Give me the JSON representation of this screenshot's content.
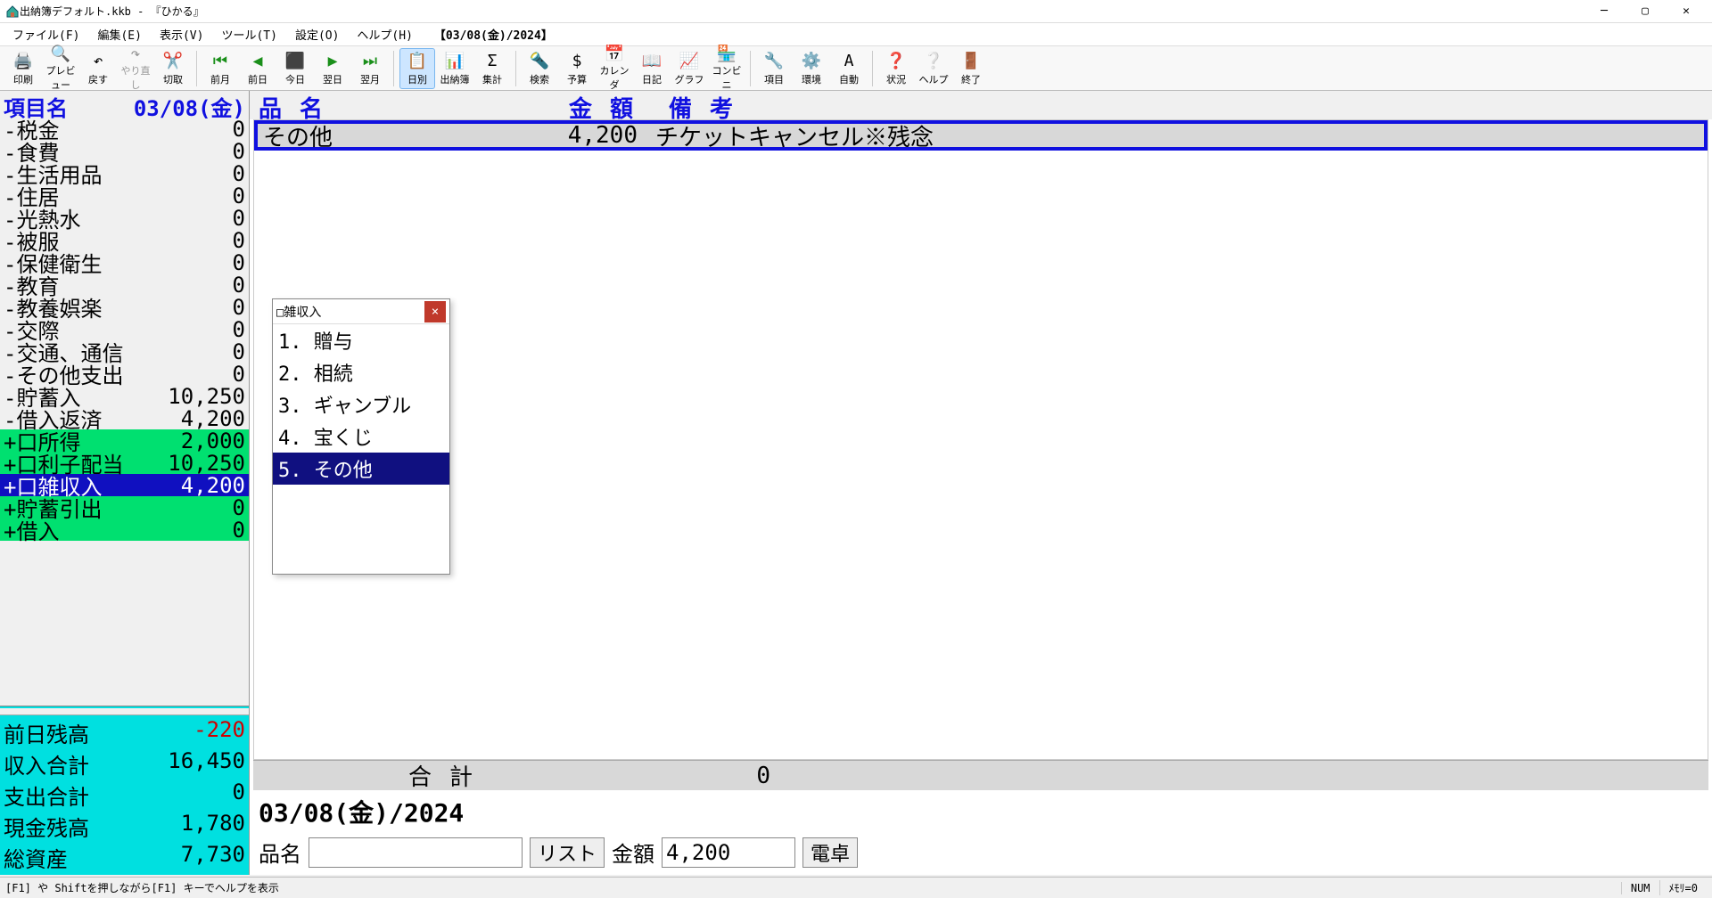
{
  "window": {
    "title": "出納簿デフォルト.kkb - 『ひかる』"
  },
  "menus": {
    "file": "ファイル(F)",
    "edit": "編集(E)",
    "view": "表示(V)",
    "tool": "ツール(T)",
    "setting": "設定(O)",
    "help": "ヘルプ(H)",
    "context": "【03/08(金)/2024】"
  },
  "toolbar": [
    {
      "id": "print",
      "lbl": "印刷",
      "ico": "🖨️"
    },
    {
      "id": "preview",
      "lbl": "プレビュー",
      "ico": "🔍"
    },
    {
      "id": "undo",
      "lbl": "戻す",
      "ico": "↶"
    },
    {
      "id": "redo",
      "lbl": "やり直し",
      "ico": "↷",
      "disabled": true
    },
    {
      "id": "cut",
      "lbl": "切取",
      "ico": "✂️"
    },
    {
      "sep": true
    },
    {
      "id": "prev-month",
      "lbl": "前月",
      "ico": "⏮",
      "color": "#1a8f1a"
    },
    {
      "id": "prev-day",
      "lbl": "前日",
      "ico": "◀",
      "color": "#1a8f1a"
    },
    {
      "id": "today",
      "lbl": "今日",
      "ico": "⬛",
      "color": "#1a8f1a"
    },
    {
      "id": "next-day",
      "lbl": "翌日",
      "ico": "▶",
      "color": "#1a8f1a"
    },
    {
      "id": "next-month",
      "lbl": "翌月",
      "ico": "⏭",
      "color": "#1a8f1a"
    },
    {
      "sep": true
    },
    {
      "id": "daily",
      "lbl": "日別",
      "ico": "📋",
      "active": true
    },
    {
      "id": "ledger",
      "lbl": "出納簿",
      "ico": "📊"
    },
    {
      "id": "summary",
      "lbl": "集計",
      "ico": "Σ"
    },
    {
      "sep": true
    },
    {
      "id": "search",
      "lbl": "検索",
      "ico": "🔦"
    },
    {
      "id": "budget",
      "lbl": "予算",
      "ico": "$"
    },
    {
      "id": "calendar",
      "lbl": "カレンダ",
      "ico": "📅"
    },
    {
      "id": "diary",
      "lbl": "日記",
      "ico": "📖"
    },
    {
      "id": "graph",
      "lbl": "グラフ",
      "ico": "📈"
    },
    {
      "id": "convini",
      "lbl": "コンビニ",
      "ico": "🏪"
    },
    {
      "sep": true
    },
    {
      "id": "item",
      "lbl": "項目",
      "ico": "🔧"
    },
    {
      "id": "env",
      "lbl": "環境",
      "ico": "⚙️"
    },
    {
      "id": "auto",
      "lbl": "自動",
      "ico": "A"
    },
    {
      "sep": true
    },
    {
      "id": "status",
      "lbl": "状況",
      "ico": "❓"
    },
    {
      "id": "help2",
      "lbl": "ヘルプ",
      "ico": "❔"
    },
    {
      "id": "exit",
      "lbl": "終了",
      "ico": "🚪"
    }
  ],
  "cat_header": {
    "left": "項目名",
    "right": "03/08(金)"
  },
  "categories": [
    {
      "nm": "-税金",
      "val": "0"
    },
    {
      "nm": "-食費",
      "val": "0"
    },
    {
      "nm": "-生活用品",
      "val": "0"
    },
    {
      "nm": "-住居",
      "val": "0"
    },
    {
      "nm": "-光熱水",
      "val": "0"
    },
    {
      "nm": "-被服",
      "val": "0"
    },
    {
      "nm": "-保健衛生",
      "val": "0"
    },
    {
      "nm": "-教育",
      "val": "0"
    },
    {
      "nm": "-教養娯楽",
      "val": "0"
    },
    {
      "nm": "-交際",
      "val": "0"
    },
    {
      "nm": "-交通、通信",
      "val": "0"
    },
    {
      "nm": "-その他支出",
      "val": "0"
    },
    {
      "nm": "-貯蓄入",
      "val": "10,250"
    },
    {
      "nm": "-借入返済",
      "val": "4,200"
    },
    {
      "nm": "+口所得",
      "val": "2,000",
      "income": true
    },
    {
      "nm": "+口利子配当",
      "val": "10,250",
      "income": true
    },
    {
      "nm": "+口雑収入",
      "val": "4,200",
      "income": true,
      "sel": true
    },
    {
      "nm": "+貯蓄引出",
      "val": "0",
      "income": true
    },
    {
      "nm": "+借入",
      "val": "0",
      "income": true
    }
  ],
  "summary": [
    {
      "nm": "前日残高",
      "val": "-220",
      "neg": true
    },
    {
      "nm": "収入合計",
      "val": "16,450"
    },
    {
      "nm": "支出合計",
      "val": "0"
    },
    {
      "nm": "現金残高",
      "val": "1,780"
    },
    {
      "nm": "総資産",
      "val": "7,730"
    }
  ],
  "detail_header": {
    "c1": "品名",
    "c2": "金額",
    "c3": "備考"
  },
  "details": [
    {
      "c1": "その他",
      "c2": "4,200",
      "c3": "チケットキャンセル※残念",
      "sel": true
    }
  ],
  "total": {
    "lbl": "合計",
    "val": "0"
  },
  "date_line": "03/08(金)/2024",
  "entry": {
    "name_lbl": "品名",
    "name_val": "",
    "list_btn": "リスト",
    "amount_lbl": "金額",
    "amount_val": "4,200",
    "calc_btn": "電卓"
  },
  "popup": {
    "title": "□雑収入",
    "items": [
      {
        "t": "1. 贈与"
      },
      {
        "t": "2. 相続"
      },
      {
        "t": "3. ギャンブル"
      },
      {
        "t": "4. 宝くじ"
      },
      {
        "t": "5. その他",
        "sel": true
      }
    ]
  },
  "status": {
    "msg": "[F1] や Shiftを押しながら[F1] キーでヘルプを表示",
    "num": "NUM",
    "mem": "ﾒﾓﾘ=0"
  }
}
